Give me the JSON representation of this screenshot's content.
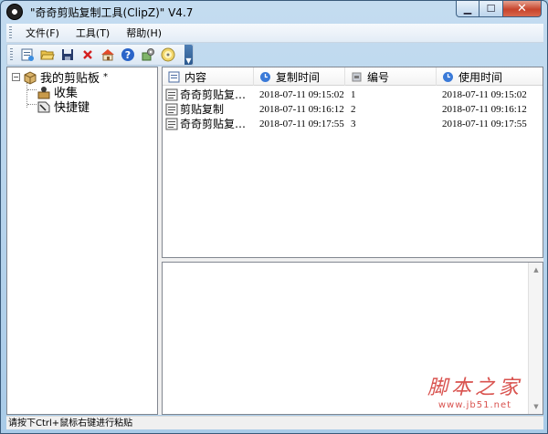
{
  "window": {
    "title": "\"奇奇剪贴复制工具(ClipZ)\"  V4.7",
    "minimize_glyph": "▁",
    "maximize_glyph": "☐",
    "close_glyph": "✕"
  },
  "menu": {
    "items": [
      {
        "label": "文件(F)"
      },
      {
        "label": "工具(T)"
      },
      {
        "label": "帮助(H)"
      }
    ]
  },
  "toolbar": {
    "buttons": [
      {
        "name": "new-clip-icon"
      },
      {
        "name": "open-folder-icon"
      },
      {
        "name": "save-icon"
      },
      {
        "name": "delete-icon"
      },
      {
        "name": "home-icon"
      },
      {
        "name": "help-icon"
      },
      {
        "name": "settings-icon"
      },
      {
        "name": "disc-icon"
      }
    ],
    "overflow_glyph": "▼"
  },
  "tree": {
    "root": {
      "label": "我的剪贴板",
      "suffix": "*",
      "toggle": "−"
    },
    "children": [
      {
        "label": "收集"
      },
      {
        "label": "快捷键"
      }
    ]
  },
  "list": {
    "columns": [
      {
        "label": "内容",
        "icon": "list-column-icon"
      },
      {
        "label": "复制时间",
        "icon": "clock-column-icon"
      },
      {
        "label": "编号",
        "icon": "number-column-icon"
      },
      {
        "label": "使用时间",
        "icon": "clock-column-icon"
      }
    ],
    "rows": [
      {
        "content": "奇奇剪贴复制工具",
        "copy_time": "2018-07-11 09:15:02",
        "number": "1",
        "use_time": "2018-07-11 09:15:02"
      },
      {
        "content": "剪贴复制",
        "copy_time": "2018-07-11 09:16:12",
        "number": "2",
        "use_time": "2018-07-11 09:16:12"
      },
      {
        "content": "奇奇剪贴复制工具",
        "copy_time": "2018-07-11 09:17:55",
        "number": "3",
        "use_time": "2018-07-11 09:17:55"
      }
    ]
  },
  "preview": {
    "scroll_up_glyph": "▲",
    "scroll_down_glyph": "▼"
  },
  "watermark": {
    "main": "脚本之家",
    "sub": "www.jb51.net"
  },
  "status": {
    "text": "请按下Ctrl+鼠标右键进行粘贴"
  },
  "colors": {
    "frame": "#a9cbe8",
    "close_button": "#c7442c",
    "watermark": "#d9534f"
  }
}
